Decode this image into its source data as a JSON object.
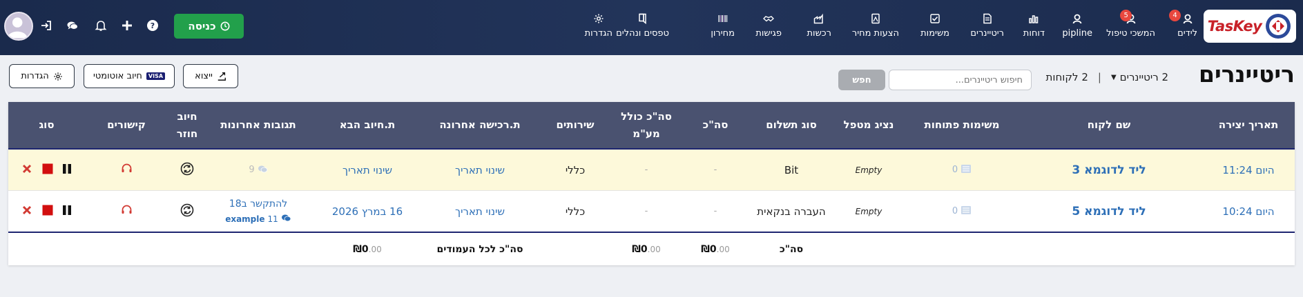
{
  "header": {
    "logo_text": "TasKey",
    "nav": [
      {
        "label": "לידים",
        "icon": "user-icon",
        "badge": "4"
      },
      {
        "label": "המשכי טיפול",
        "icon": "user-icon",
        "badge": "5"
      },
      {
        "label": "pipline",
        "icon": "user-icon",
        "badge": ""
      },
      {
        "label": "דוחות",
        "icon": "chart-icon",
        "badge": ""
      },
      {
        "label": "ריטיינרים",
        "icon": "document-icon",
        "badge": ""
      },
      {
        "label": "משימות",
        "icon": "checkbox-icon",
        "badge": ""
      },
      {
        "label": "הצעות מחיר",
        "icon": "quote-icon",
        "badge": ""
      },
      {
        "label": "רכשות",
        "icon": "factory-icon",
        "badge": ""
      },
      {
        "label": "פגישות",
        "icon": "handshake-icon",
        "badge": ""
      },
      {
        "label": "מחירון",
        "icon": "barcode-icon",
        "badge": ""
      },
      {
        "label": "טפסים ונהלים",
        "icon": "form-icon",
        "badge": ""
      },
      {
        "label": "הגדרות",
        "icon": "gear-icon",
        "badge": ""
      }
    ],
    "enter_button": "כניסה",
    "accent_green": "#22a04b",
    "badge_color": "#e8473e"
  },
  "page": {
    "title": "ריטיינרים",
    "retainers_count": "2 ריטיינרים",
    "clients_count": "2 לקוחות",
    "search_placeholder": "חיפוש ריטיינרים...",
    "search_button": "חפש",
    "export_button": "ייצוא",
    "auto_charge_button": "חיוב אוטומטי",
    "settings_button": "הגדרות"
  },
  "table": {
    "columns": [
      "תאריך יצירה",
      "שם לקוח",
      "משימות פתוחות",
      "נציג מטפל",
      "סוג תשלום",
      "סה\"כ",
      "סה\"כ כולל מע\"מ",
      "שירותים",
      "ת.רכישה אחרונה",
      "ת.חיוב הבא",
      "תגובות אחרונות",
      "חיוב חוזר",
      "קישורים",
      "סוג"
    ],
    "rows": [
      {
        "created": "היום 11:24",
        "client": "ליד לדוגמא 3",
        "open_tasks": "0",
        "rep": "Empty",
        "payment_type": "Bit",
        "total": "-",
        "total_vat": "-",
        "services": "כללי",
        "last_purchase": "שינוי תאריך",
        "next_charge": "שינוי תאריך",
        "comment_text": "",
        "comment_count": "9",
        "comment_author": ""
      },
      {
        "created": "היום 10:24",
        "client": "ליד לדוגמא 5",
        "open_tasks": "0",
        "rep": "Empty",
        "payment_type": "העברה בנקאית",
        "total": "-",
        "total_vat": "-",
        "services": "כללי",
        "last_purchase": "שינוי תאריך",
        "next_charge": "16 במרץ 2026",
        "comment_text": "להתקשר ב18",
        "comment_count": "11",
        "comment_author": "example"
      }
    ],
    "footer": {
      "total_label": "סה\"כ",
      "total_value": "₪0",
      "total_dec": ".00",
      "total_vat_value": "₪0",
      "total_vat_dec": ".00",
      "all_columns_label": "סה\"כ לכל העמודים",
      "all_columns_value": "₪0",
      "all_columns_dec": ".00"
    }
  }
}
